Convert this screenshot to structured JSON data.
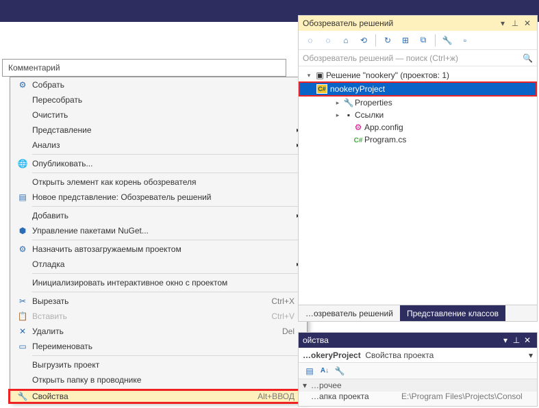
{
  "comment": {
    "label": "Комментарий"
  },
  "context_menu": [
    {
      "label": "Собрать",
      "icon": "build",
      "has_sep_after": false
    },
    {
      "label": "Пересобрать"
    },
    {
      "label": "Очистить"
    },
    {
      "label": "Представление",
      "sub": true
    },
    {
      "label": "Анализ",
      "sub": true,
      "sep_after": true
    },
    {
      "label": "Опубликовать...",
      "icon": "globe",
      "sep_after": true
    },
    {
      "label": "Открыть элемент как корень обозревателя"
    },
    {
      "label": "Новое представление: Обозреватель решений",
      "icon": "newview",
      "sep_after": true
    },
    {
      "label": "Добавить",
      "sub": true
    },
    {
      "label": "Управление пакетами NuGet...",
      "icon": "nuget",
      "sep_after": true
    },
    {
      "label": "Назначить автозагружаемым проектом",
      "icon": "startup"
    },
    {
      "label": "Отладка",
      "sub": true,
      "sep_after": true
    },
    {
      "label": "Инициализировать интерактивное окно с проектом",
      "sep_after": true
    },
    {
      "label": "Вырезать",
      "shortcut": "Ctrl+X",
      "icon": "cut"
    },
    {
      "label": "Вставить",
      "shortcut": "Ctrl+V",
      "icon": "paste",
      "disabled": true
    },
    {
      "label": "Удалить",
      "shortcut": "Del",
      "icon": "delete"
    },
    {
      "label": "Переименовать",
      "icon": "rename",
      "sep_after": true
    },
    {
      "label": "Выгрузить проект"
    },
    {
      "label": "Открыть папку в проводнике",
      "sep_after": true
    },
    {
      "label": "Свойства",
      "shortcut": "Alt+ВВОД",
      "icon": "wrench",
      "highlight": true,
      "redbox": true
    }
  ],
  "solution_explorer": {
    "title": "Обозреватель решений",
    "search_placeholder": "Обозреватель решений — поиск (Ctrl+ж)",
    "solution_label": "Решение \"nookery\"  (проектов: 1)",
    "project": "nookeryProject",
    "nodes": [
      {
        "label": "Properties",
        "icon": "wrench",
        "indent": 3,
        "exp": "▸"
      },
      {
        "label": "Ссылки",
        "icon": "refs",
        "indent": 3,
        "exp": "▸"
      },
      {
        "label": "App.config",
        "icon": "cfg",
        "indent": 4,
        "exp": ""
      },
      {
        "label": "Program.cs",
        "icon": "cs",
        "indent": 4,
        "exp": ""
      }
    ],
    "tabs": {
      "left": "…озреватель решений",
      "right": "Представление классов"
    }
  },
  "properties": {
    "title": "ойства",
    "combo_a": "…okeryProject",
    "combo_b": "Свойства проекта",
    "category": "…рочее",
    "row_key": "…апка проекта",
    "row_val": "E:\\Program Files\\Projects\\Consol"
  }
}
